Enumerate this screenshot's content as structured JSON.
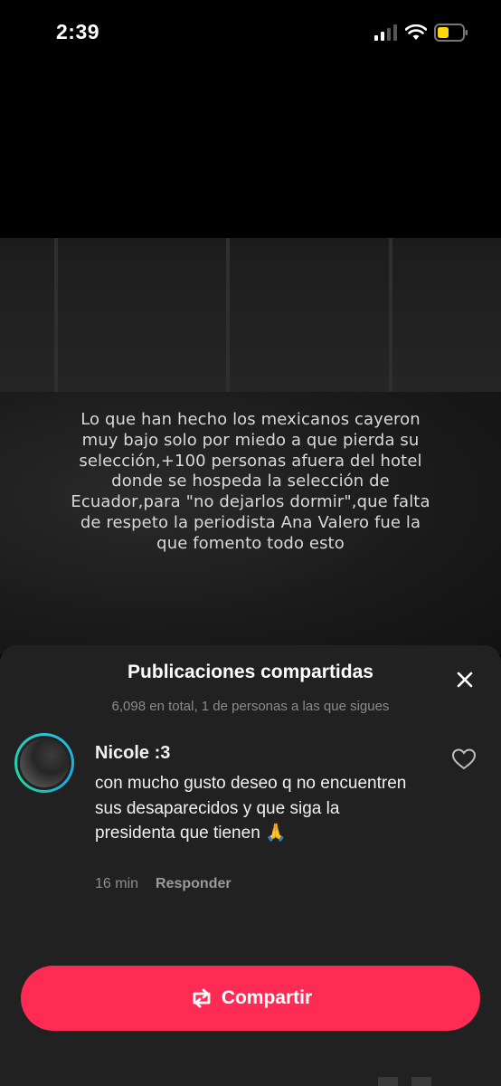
{
  "status_bar": {
    "time": "2:39"
  },
  "video": {
    "overlay_text": "Lo que han hecho los mexicanos cayeron muy bajo solo por miedo a que pierda su selección,+100 personas afuera del hotel donde se hospeda la selección de Ecuador,para \"no dejarlos dormir\",que falta de respeto la periodista Ana Valero fue la que fomento todo esto"
  },
  "sheet": {
    "title": "Publicaciones compartidas",
    "subtitle": "6,098 en total, 1 de personas a las que sigues",
    "close_icon": "close-icon",
    "comment": {
      "username": "Nicole :3",
      "text": "con mucho gusto deseo q no encuentren sus desaparecidos y que siga la presidenta que tienen 🙏",
      "time": "16 min",
      "reply_label": "Responder",
      "like_icon": "heart-outline-icon"
    },
    "share_button": {
      "label": "Compartir",
      "icon": "repost-icon",
      "color": "#fe2c55"
    }
  }
}
